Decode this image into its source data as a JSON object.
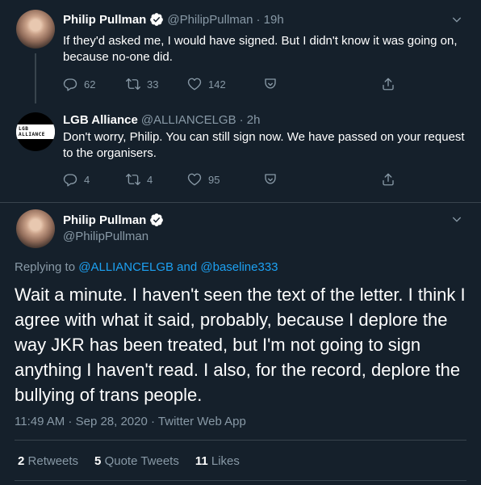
{
  "tweets": [
    {
      "name": "Philip Pullman",
      "handle": "@PhilipPullman",
      "time": "· 19h",
      "text": "If they'd asked me, I would have signed. But I didn't know it was going on, because no-one did.",
      "replies": "62",
      "retweets": "33",
      "likes": "142"
    },
    {
      "name": "LGB Alliance",
      "handle": "@ALLIANCELGB",
      "time": "· 2h",
      "avatar_text": "LGB ALLIANCE",
      "text": "Don't worry, Philip. You can still sign now. We have passed on your request to the organisers.",
      "replies": "4",
      "retweets": "4",
      "likes": "95"
    }
  ],
  "main_tweet": {
    "name": "Philip Pullman",
    "handle": "@PhilipPullman",
    "replying_prefix": "Replying to",
    "replying_user1": "@ALLIANCELGB",
    "replying_and": "and",
    "replying_user2": "@baseline333",
    "text": "Wait a minute. I haven't seen the text of the letter. I think I agree with what it said, probably, because I deplore the way JKR has been treated, but I'm not going to sign anything I haven't read. I also, for the record, deplore the bullying of trans people.",
    "timestamp": "11:49 AM · Sep 28, 2020 · Twitter Web App",
    "retweets_count": "2",
    "retweets_label": "Retweets",
    "quote_count": "5",
    "quote_label": "Quote Tweets",
    "likes_count": "11",
    "likes_label": "Likes"
  },
  "colors": {
    "background": "#15202b",
    "secondary_text": "#8899a6",
    "link": "#1da1f2",
    "divider": "#38444d"
  },
  "icons": [
    "verified-icon",
    "chevron-down-icon",
    "reply-icon",
    "retweet-icon",
    "like-icon",
    "bookmark-icon",
    "share-icon"
  ]
}
